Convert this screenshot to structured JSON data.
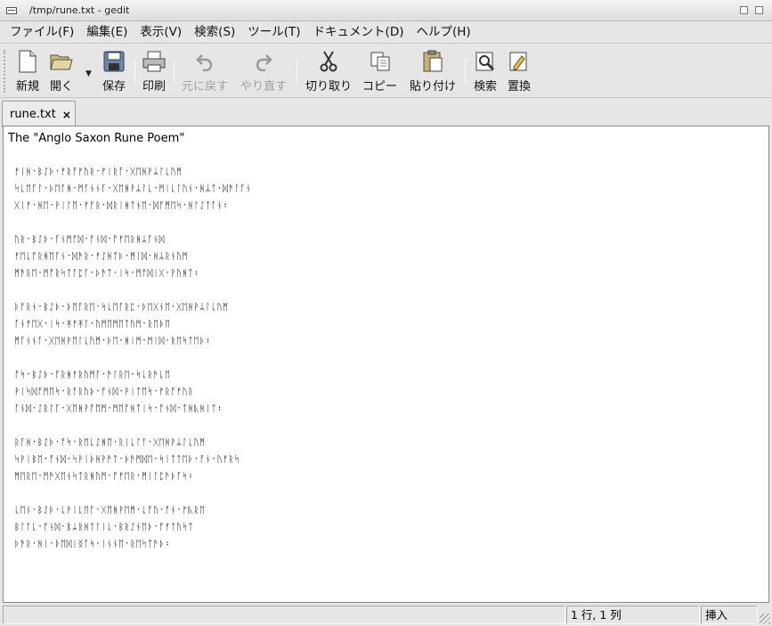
{
  "window": {
    "title": "/tmp/rune.txt - gedit"
  },
  "menubar": {
    "items": [
      "ファイル(F)",
      "編集(E)",
      "表示(V)",
      "検索(S)",
      "ツール(T)",
      "ドキュメント(D)",
      "ヘルプ(H)"
    ]
  },
  "toolbar": {
    "new": "新規",
    "open": "開く",
    "save": "保存",
    "print": "印刷",
    "undo": "元に戻す",
    "redo": "やり直す",
    "cut": "切り取り",
    "copy": "コピー",
    "paste": "貼り付け",
    "find": "検索",
    "replace": "置換"
  },
  "tab": {
    "label": "rune.txt",
    "close": "×"
  },
  "document": {
    "lines": [
      "The \"Anglo Saxon Rune Poem\"",
      "",
      "ᚠᛁᚻ᛫ᛒᛇᚦ᛫ᚠᚱᚩᚠᚢᚱ᛫ᚠᛁᚱᚪ᛫ᚷᛖᚻᚹᛦᛚᚳᚢᛗ",
      "ᛋᚳᛖᚪᛚ᛫ᚦᛖᚪᚻ᛫ᛗᚪᚾᚾᚪ᛫ᚷᛖᚻᚹᛦᛚᚳ᛫ᛗᛁᚳᛚᚢᚾ᛫ᚻᛦᛏ᛫ᛞᚫᛚᚪᚾ",
      "ᚷᛁᚠ᛫ᚻᛖ᛫ᚹᛁᛚᛖ᛫ᚠᚩᚱ᛫ᛞᚱᛁᚻᛏᚾᛖ᛫ᛞᚩᛗᛖᛋ᛫ᚻᛚᛇᛏᚪᚾ᛬",
      "",
      "ᚢᚱ᛫ᛒᛇᚦ᛫ᚪᚾᛗᚩᛞ᛫ᚩᚾᛞ᛫ᚩᚠᛖᚱᚻᛦᚪᚾᛞ",
      "ᚠᛖᚳᚩᚱᚻᛖᚪᚾ᛫ᛞᚫᚱ᛫ᚠᛇᚻᛏᚦ᛫ᛗᛁᛞ᛫ᚻᛦᚱᚾᚢᛗ",
      "ᛗᚫᚱᛖ᛫ᛗᚩᚱᛋᛏᚪᛈᚪ᛫ᚦᚫᛏ᛫ᛁᛋ᛫ᛗᚩᛞᛁᚷ᛫ᚹᚢᚻᛏ᛬",
      "",
      "ᚦᚩᚱᚾ᛫ᛒᛇᚦ᛫ᚦᛖᚪᚱᛖ᛫ᛋᚳᛖᚪᚱᛈ᛫ᚦᛖᚷᚾᛖ᛫ᚷᛖᚻᚹᛦᛚᚳᚢᛗ",
      "ᚪᚾᚠᛖᚷ᛫ᛁᛋ᛫ᛡᚠᛡᛚ᛫ᚢᛗᛖᛗᛖᛏᚢᛗ᛫ᚱᛖᚦᛖ",
      "ᛗᚪᚾᚾᚪ᛫ᚷᛖᚻᚹᛖᛚᚳᚢᛗ᛫ᚦᛖ᛫ᚻᛁᛗ᛫ᛗᛁᛞ᛫ᚱᛖᛋᛏᛖᚦ᛬",
      "",
      "ᚩᛋ᛫ᛒᛇᚦ᛫ᚩᚱᚻᚠᚱᚢᛗᚪ᛫ᚫᛚᚱᛖ᛫ᛋᚳᚱᚫᚳᛖ",
      "ᚹᛁᛋᛞᚩᛗᛖᛋ᛫ᚱᚩᚱᚢᚦ᛫ᚩᚾᛞ᛫ᚹᛁᛏᛖᛋ᛫ᚠᚱᚩᚠᚢᚱ",
      "ᚪᚾᛞ᛫ᛇᚱᛚᚪ᛫ᚷᛖᚻᚹᚩᛖᛗ᛫ᛗᛖᚩᚻᛏᛁᛋ᛫ᚩᚾᛞ᛫ᛏᚻᚣᚻᛁᛏ᛬",
      "",
      "ᚱᚪᚻ᛫ᛒᛇᚦ᛫ᚩᛋ᛫ᚱᛖᚳᛇᚻᛖ᛫ᚱᛁᚳᛚᚪ᛫ᚷᛖᚻᚹᛦᛚᚳᚢᛗ",
      "ᛋᚹᛁᛒᛖ᛫ᚩᚾᛞ᛫ᛋᚹᛁᚦᚻᚹᚫᛏ᛫ᚦᚫᛗᛞᛖ᛫ᛋᛁᛏᛏᛖᚦ᛫ᚩᚾ᛫ᚢᚠᚱᛋ",
      "ᛗᛖᚱᛖ᛫ᛗᚫᚷᛖᚾᛋᛏᚱᚻᚢᛗ᛫ᚩᚠᛖᚱ᛫ᛗᛁᛚᛈᚫᚦᚪᛋ᛬",
      "",
      "ᚳᛖᚾ᛫ᛒᛇᚦ᛫ᚳᚹᛁᚳᛖᚪ᛫ᚷᛖᚻᚹᛖᛗ᛫ᚳᚩᚢ᛫ᚩᚾ᛫ᚠᚣᚱᛖ",
      "ᛒᛚᚪᚳ᛫ᚩᚾᛞ᛫ᛒᛦᚱᚻᛏᛚᛁᚳ᛫ᛒᚱᛇᚾᛖᚦ᛫ᚩᚠᛏᚢᛋᛏ",
      "ᚦᚫᚱ᛫ᚻᛁ᛫ᚦᛖᛞᛁᛝᚪᛋ᛫ᛁᚾᚾᛖ᛫ᚱᛖᛋᛏᚫᚦ᛬"
    ]
  },
  "statusbar": {
    "position": "1 行, 1 列",
    "mode": "挿入"
  },
  "colors": {
    "background": "#e6e6e6",
    "editor_bg": "#ffffff",
    "disabled_text": "#a0a0a0"
  }
}
